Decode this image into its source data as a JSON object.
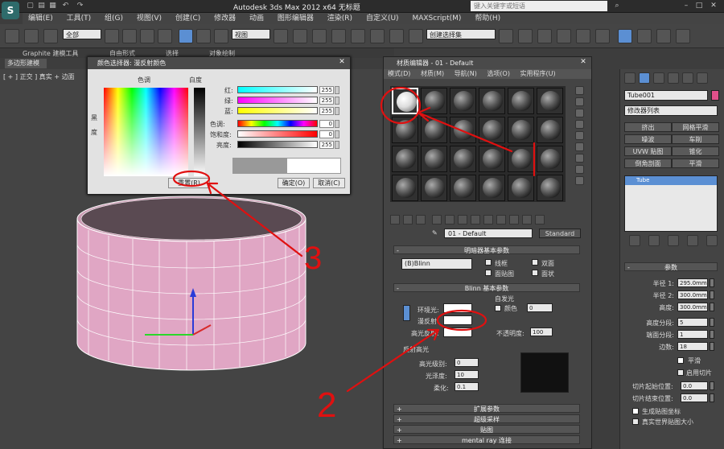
{
  "app": {
    "logo": "S",
    "title": "Autodesk 3ds Max  2012 x64      无标题",
    "search_placeholder": "键入关键字或短语"
  },
  "menu": [
    "编辑(E)",
    "工具(T)",
    "组(G)",
    "视图(V)",
    "创建(C)",
    "修改器",
    "动画",
    "图形编辑器",
    "渲染(R)",
    "自定义(U)",
    "MAXScript(M)",
    "帮助(H)"
  ],
  "toolbar": {
    "filter": "全部",
    "ref_coord": "视图",
    "named_sel": "创建选择集"
  },
  "ribbon": {
    "tabs": [
      "Graphite 建模工具",
      "自由形式",
      "选择",
      "对象绘制"
    ],
    "subtab": "多边形建模"
  },
  "viewport": {
    "label": "[ + ] 正交 ] 真实 + 边面"
  },
  "color_picker": {
    "title": "颜色选择器: 漫反射颜色",
    "hue_label": "色调",
    "white_label": "白度",
    "black_label": "黑",
    "degree_label": "度",
    "sliders": [
      {
        "label": "红:",
        "value": "255",
        "bar": "linear-gradient(to right,#00ffff,#ffffff)"
      },
      {
        "label": "绿:",
        "value": "255",
        "bar": "linear-gradient(to right,#ff00ff,#ffffff)"
      },
      {
        "label": "蓝:",
        "value": "255",
        "bar": "linear-gradient(to right,#ffff00,#ffffff)"
      },
      {
        "label": "色调:",
        "value": "0",
        "bar": "linear-gradient(to right,#f00,#ff0,#0f0,#0ff,#00f,#f0f,#f00)"
      },
      {
        "label": "饱和度:",
        "value": "0",
        "bar": "linear-gradient(to right,#ffffff,#ff0000)"
      },
      {
        "label": "亮度:",
        "value": "255",
        "bar": "linear-gradient(to right,#000000,#ffffff)"
      }
    ],
    "reset": "重置(R)",
    "ok": "确定(O)",
    "cancel": "取消(C)"
  },
  "material_editor": {
    "title": "材质编辑器 - 01 - Default",
    "menu": [
      "模式(D)",
      "材质(M)",
      "导航(N)",
      "选项(O)",
      "实用程序(U)"
    ],
    "material_name": "01 - Default",
    "type_button": "Standard",
    "shader_rollout": "明暗器基本参数",
    "shader_type": "(B)Blinn",
    "shader_opts": [
      "线框",
      "双面",
      "面贴图",
      "面状"
    ],
    "blinn_rollout": "Blinn 基本参数",
    "self_illum": "自发光",
    "color_label": "颜色",
    "self_illum_value": "0",
    "ambient": "环境光:",
    "diffuse": "漫反射:",
    "specular": "高光反射:",
    "opacity_label": "不透明度:",
    "opacity": "100",
    "spec_highlights": "反射高光",
    "spec_level_label": "高光级别:",
    "spec_level": "0",
    "gloss_label": "光泽度:",
    "gloss": "10",
    "soften_label": "柔化:",
    "soften": "0.1",
    "rollouts": [
      "扩展参数",
      "超级采样",
      "贴图",
      "mental ray 连接"
    ]
  },
  "command_panel": {
    "object_name": "Tube001",
    "modifier_list": "修改器列表",
    "modifier_buttons": [
      "挤出",
      "网格平滑",
      "噪波",
      "车削",
      "UVW 贴图",
      "锥化",
      "倒角剖面",
      "平滑"
    ],
    "stack_item": "Tube",
    "params_rollout": "参数",
    "params": [
      {
        "label": "半径 1:",
        "value": "295.0mm"
      },
      {
        "label": "半径 2:",
        "value": "300.0mm"
      },
      {
        "label": "高度:",
        "value": "300.0mm"
      },
      {
        "label": "高度分段:",
        "value": "5"
      },
      {
        "label": "端面分段:",
        "value": "1"
      },
      {
        "label": "边数:",
        "value": "18"
      }
    ],
    "smooth": "平滑",
    "enable_slice": "启用切片",
    "slice_from": "切片起始位置:",
    "slice_to": "切片结束位置:",
    "slice_from_value": "0.0",
    "slice_to_value": "0.0",
    "gen_map": "生成贴图坐标",
    "real_world": "真实世界贴图大小"
  },
  "annotations": {
    "n2": "2",
    "n3": "3"
  },
  "colors": {
    "tube": "#e0a6c4",
    "annotation": "#e01010",
    "selection": "#5b8fd3"
  }
}
